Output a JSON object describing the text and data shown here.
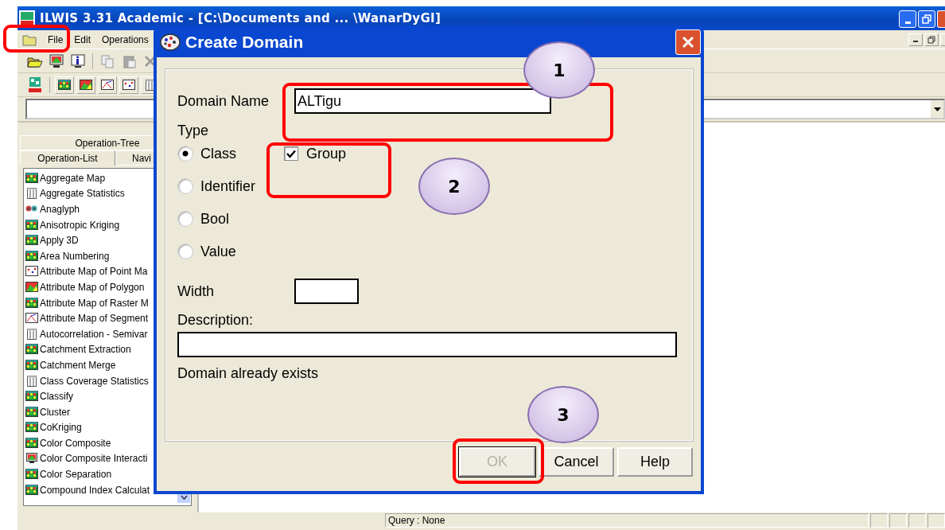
{
  "main_window": {
    "title": "ILWIS 3.31 Academic - [C:\\Documents and ... \\WanarDyGI]",
    "menu": [
      "File",
      "Edit",
      "Operations"
    ],
    "operation_tabs": [
      [
        {
          "label": "Operation-Tree",
          "selected": false
        }
      ],
      [
        {
          "label": "Operation-List",
          "selected": true
        },
        {
          "label": "Navi",
          "selected": false
        }
      ]
    ],
    "operations": [
      {
        "label": "Aggregate Map",
        "kind": "raster"
      },
      {
        "label": "Aggregate Statistics",
        "kind": "table"
      },
      {
        "label": "Anaglyph",
        "kind": "anaglyph"
      },
      {
        "label": "Anisotropic Kriging",
        "kind": "raster"
      },
      {
        "label": "Apply 3D",
        "kind": "raster"
      },
      {
        "label": "Area Numbering",
        "kind": "raster"
      },
      {
        "label": "Attribute Map of Point Ma",
        "kind": "point"
      },
      {
        "label": "Attribute Map of Polygon",
        "kind": "polygon"
      },
      {
        "label": "Attribute Map of Raster M",
        "kind": "raster"
      },
      {
        "label": "Attribute Map of Segment",
        "kind": "segment"
      },
      {
        "label": "Autocorrelation - Semivar",
        "kind": "table"
      },
      {
        "label": "Catchment Extraction",
        "kind": "raster"
      },
      {
        "label": "Catchment Merge",
        "kind": "raster"
      },
      {
        "label": "Class Coverage Statistics",
        "kind": "table"
      },
      {
        "label": "Classify",
        "kind": "raster"
      },
      {
        "label": "Cluster",
        "kind": "raster"
      },
      {
        "label": "CoKriging",
        "kind": "raster"
      },
      {
        "label": "Color Composite",
        "kind": "raster"
      },
      {
        "label": "Color Composite Interacti",
        "kind": "display"
      },
      {
        "label": "Color Separation",
        "kind": "raster"
      },
      {
        "label": "Compound Index Calculat",
        "kind": "raster"
      }
    ],
    "status_bar": {
      "query": "Query : None"
    }
  },
  "dialog": {
    "title": "Create Domain",
    "domain_name": {
      "label": "Domain Name",
      "value": "ALTigu"
    },
    "type_label": "Type",
    "types": [
      {
        "label": "Class",
        "selected": true
      },
      {
        "label": "Identifier",
        "selected": false
      },
      {
        "label": "Bool",
        "selected": false
      },
      {
        "label": "Value",
        "selected": false
      }
    ],
    "group": {
      "label": "Group",
      "checked": true
    },
    "width": {
      "label": "Width"
    },
    "description": {
      "label": "Description:"
    },
    "message": "Domain already exists",
    "buttons": [
      {
        "label": "OK",
        "disabled": true
      },
      {
        "label": "Cancel",
        "disabled": false
      },
      {
        "label": "Help",
        "disabled": false
      }
    ]
  },
  "annotations": [
    {
      "label": "1"
    },
    {
      "label": "2"
    },
    {
      "label": "3"
    }
  ]
}
